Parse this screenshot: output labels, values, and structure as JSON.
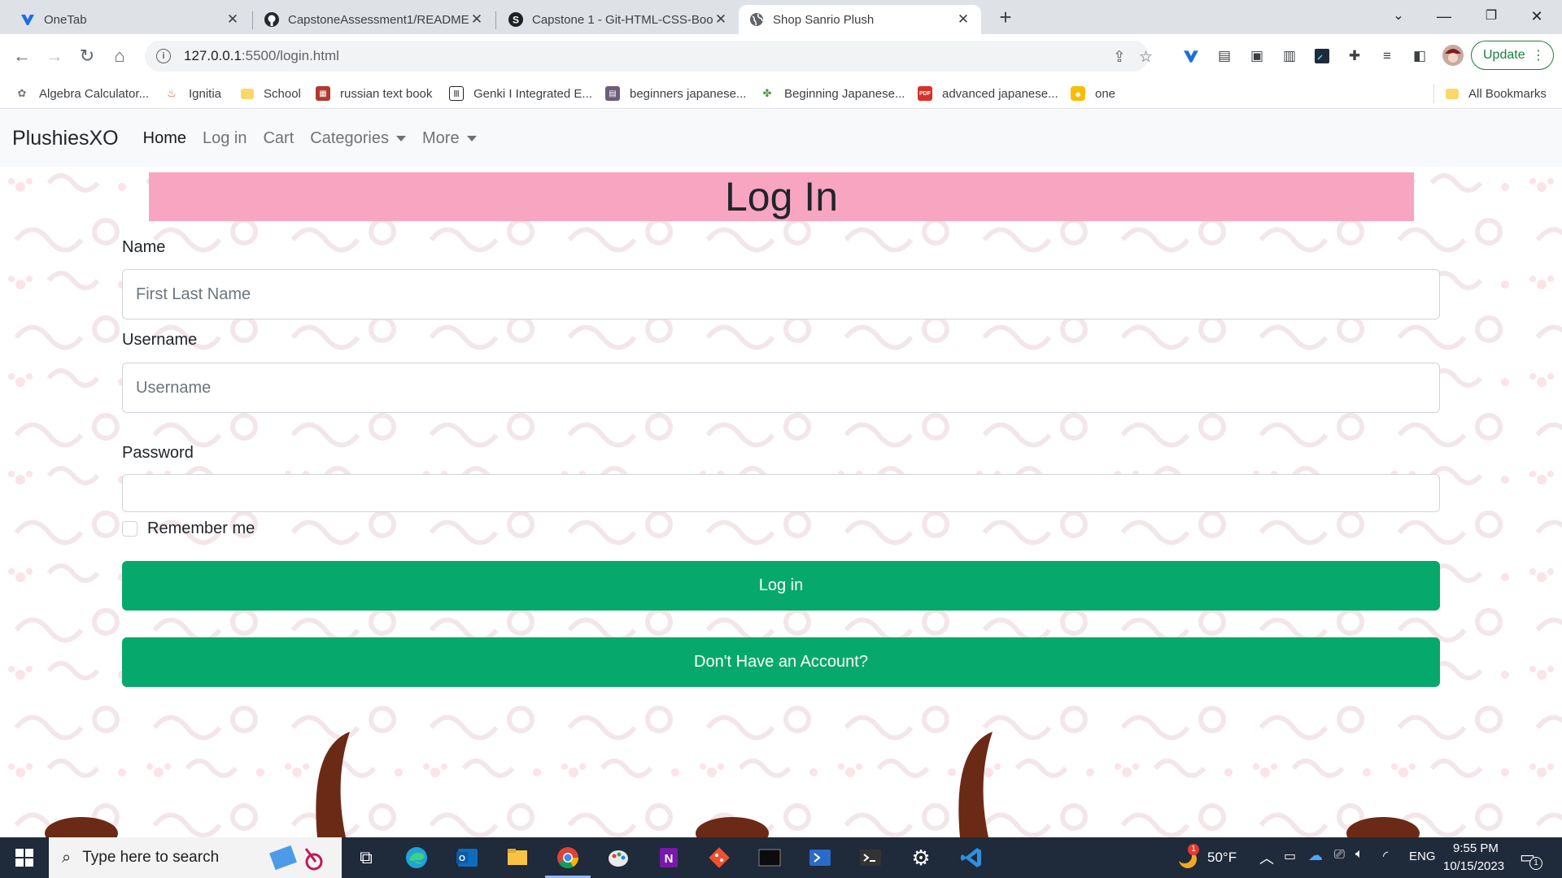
{
  "browser": {
    "tabs": [
      {
        "title": "OneTab",
        "icon": "onetab-icon",
        "active": false
      },
      {
        "title": "CapstoneAssessment1/README",
        "icon": "github-icon",
        "active": false
      },
      {
        "title": "Capstone 1 - Git-HTML-CSS-Boo",
        "icon": "skilldistillery-icon",
        "active": false
      },
      {
        "title": "Shop Sanrio Plush",
        "icon": "globe-icon",
        "active": true
      }
    ],
    "url_host": "127.0.0.1",
    "url_path": ":5500/login.html",
    "update_label": "Update",
    "bookmarks": [
      {
        "label": "Algebra Calculator...",
        "icon": "algebra-icon"
      },
      {
        "label": "Ignitia",
        "icon": "ignitia-icon"
      },
      {
        "label": "School",
        "icon": "folder-icon"
      },
      {
        "label": "russian text book",
        "icon": "book-icon"
      },
      {
        "label": "Genki I Integrated E...",
        "icon": "library-icon"
      },
      {
        "label": "beginners japanese...",
        "icon": "page-icon"
      },
      {
        "label": "Beginning Japanese...",
        "icon": "puzzle-icon"
      },
      {
        "label": "advanced japanese...",
        "icon": "pdf-icon"
      },
      {
        "label": "one",
        "icon": "keep-icon"
      }
    ],
    "all_bookmarks_label": "All Bookmarks"
  },
  "site": {
    "brand": "PlushiesXO",
    "nav": {
      "home": "Home",
      "login": "Log in",
      "cart": "Cart",
      "categories": "Categories",
      "more": "More"
    },
    "banner_title": "Log In",
    "form": {
      "name_label": "Name",
      "name_placeholder": "First Last Name",
      "username_label": "Username",
      "username_placeholder": "Username",
      "password_label": "Password",
      "remember_label": "Remember me",
      "login_button": "Log in",
      "signup_button": "Don't Have an Account?"
    },
    "colors": {
      "banner": "#f8a5c2",
      "button": "#06a96b",
      "navbar": "#f8f9fa"
    }
  },
  "taskbar": {
    "search_placeholder": "Type here to search",
    "weather_temp": "50°F",
    "weather_badge": "1",
    "language": "ENG",
    "time": "9:55 PM",
    "date": "10/15/2023",
    "notification_count": "1"
  }
}
